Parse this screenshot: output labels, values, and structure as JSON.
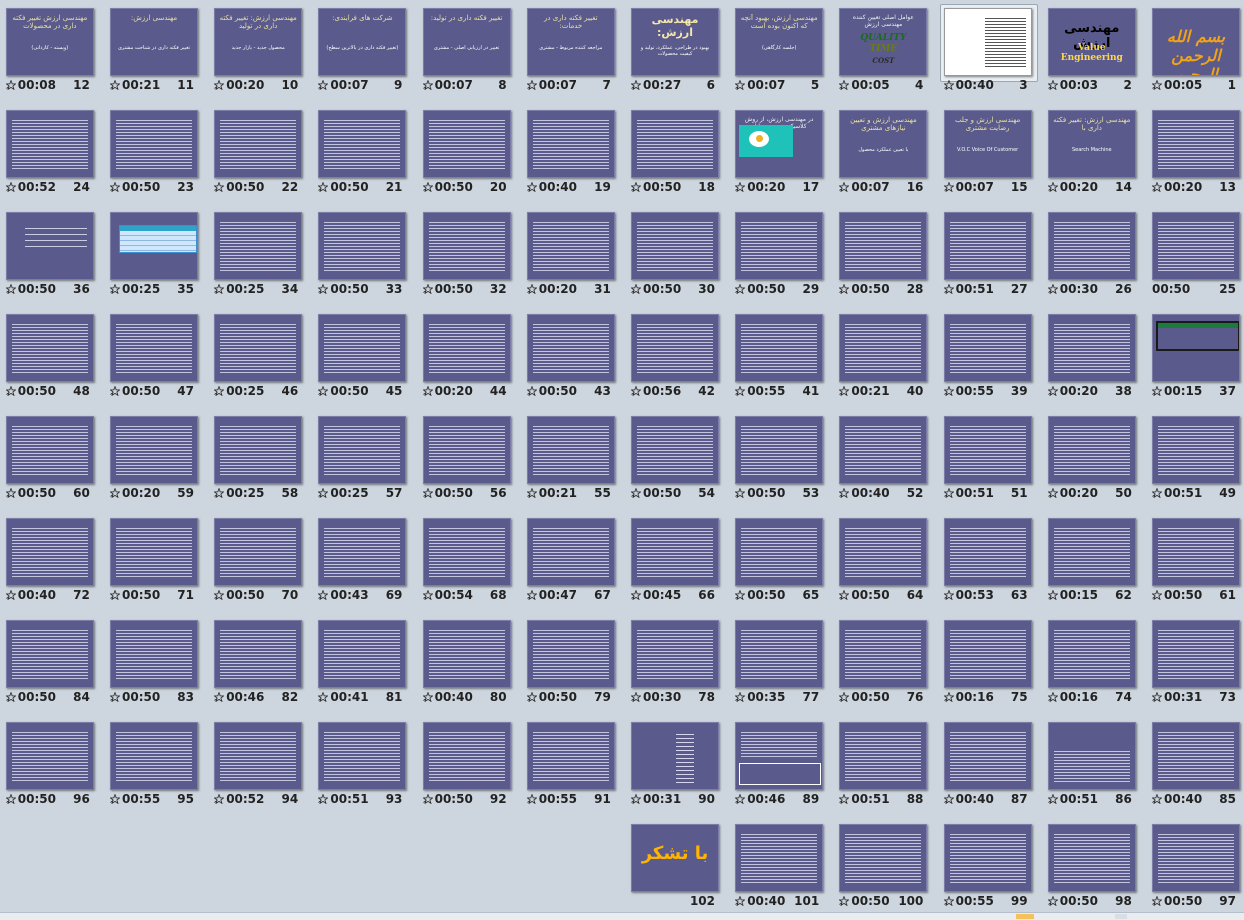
{
  "view": "slide-sorter",
  "colors": {
    "slide_bg": "#5a5a8c",
    "workspace_bg": "#cdd5de",
    "accent_gold": "#f0a218"
  },
  "selected_slide": 3,
  "slides": [
    {
      "num": "1",
      "time": "00:05",
      "kind": "bismillah",
      "title": "بسم الله الرحمن الرحیم"
    },
    {
      "num": "2",
      "time": "00:03",
      "kind": "ve-logo",
      "title": "مهندسی ارزش",
      "sub": "Value Engineering"
    },
    {
      "num": "3",
      "time": "00:40",
      "kind": "white-text"
    },
    {
      "num": "4",
      "time": "00:05",
      "kind": "qtc",
      "title": "عوامل اصلی تعیین کننده مهندسی ارزش",
      "lines3": [
        "QUALITY",
        "TIME",
        "COST"
      ]
    },
    {
      "num": "5",
      "time": "00:07",
      "kind": "title",
      "title": "مهندسی ارزش، بهبود آنچه که اکنون بوده است",
      "sub": "(جلسه کارگاهی)"
    },
    {
      "num": "6",
      "time": "00:27",
      "kind": "title-big",
      "title": "مهندسی ارزش:",
      "sub": "بهبود در طراحی، عملکرد، تولید و کیفیت محصولات"
    },
    {
      "num": "7",
      "time": "00:07",
      "kind": "title",
      "title": "تغییر فکته داری در خدمات:",
      "sub": "مراجعه کننده مربوط - مشتری"
    },
    {
      "num": "8",
      "time": "00:07",
      "kind": "title",
      "title": "تغییر فکته داری در تولید:",
      "sub": "تغییر در ارزیابی اصلی - مشتری"
    },
    {
      "num": "9",
      "time": "00:07",
      "kind": "title",
      "title": "شرکت های فرایندی:",
      "sub": "(تغییر فکته داری در بالاترین سطح)"
    },
    {
      "num": "10",
      "time": "00:20",
      "kind": "title",
      "title": "مهندسی ارزش: تغییر فکته داری در تولید",
      "sub": "محصول جدید - بازار جدید"
    },
    {
      "num": "11",
      "time": "00:21",
      "kind": "title",
      "title": "مهندسی ارزش:",
      "sub": "تغییر فکته داری در شناخت مشتری"
    },
    {
      "num": "12",
      "time": "00:08",
      "kind": "title",
      "title": "مهندسی ارزش تغییر فکته داری در محصولات",
      "sub": "(ویسته - کاردانی)"
    },
    {
      "num": "13",
      "time": "00:20",
      "kind": "text"
    },
    {
      "num": "14",
      "time": "00:20",
      "kind": "title",
      "title": "مهندسی ارزش: تغییر فکته داری با",
      "sub": "Search Machine"
    },
    {
      "num": "15",
      "time": "00:07",
      "kind": "title",
      "title": "مهندسی ارزش و جلب رضایت مشتری",
      "sub": "V.O.C Voice Of Customer"
    },
    {
      "num": "16",
      "time": "00:07",
      "kind": "title",
      "title": "مهندسی ارزش و تعیین نیازهای مشتری",
      "sub": "با تعیین عملکرد محصول"
    },
    {
      "num": "17",
      "time": "00:20",
      "kind": "image17",
      "title": "در مهندسی ارزش، از روش کلاسیک تجزیه و تحلیل"
    },
    {
      "num": "18",
      "time": "00:50",
      "kind": "text"
    },
    {
      "num": "19",
      "time": "00:40",
      "kind": "text"
    },
    {
      "num": "20",
      "time": "00:50",
      "kind": "text"
    },
    {
      "num": "21",
      "time": "00:50",
      "kind": "text"
    },
    {
      "num": "22",
      "time": "00:50",
      "kind": "text"
    },
    {
      "num": "23",
      "time": "00:50",
      "kind": "text"
    },
    {
      "num": "24",
      "time": "00:52",
      "kind": "text"
    },
    {
      "num": "25",
      "time": "00:50",
      "kind": "text",
      "nostar": true
    },
    {
      "num": "26",
      "time": "00:30",
      "kind": "text"
    },
    {
      "num": "27",
      "time": "00:51",
      "kind": "text"
    },
    {
      "num": "28",
      "time": "00:50",
      "kind": "text"
    },
    {
      "num": "29",
      "time": "00:50",
      "kind": "text"
    },
    {
      "num": "30",
      "time": "00:50",
      "kind": "text"
    },
    {
      "num": "31",
      "time": "00:20",
      "kind": "text"
    },
    {
      "num": "32",
      "time": "00:50",
      "kind": "text"
    },
    {
      "num": "33",
      "time": "00:50",
      "kind": "text"
    },
    {
      "num": "34",
      "time": "00:25",
      "kind": "text"
    },
    {
      "num": "35",
      "time": "00:25",
      "kind": "table"
    },
    {
      "num": "36",
      "time": "00:50",
      "kind": "sparse"
    },
    {
      "num": "37",
      "time": "00:15",
      "kind": "box"
    },
    {
      "num": "38",
      "time": "00:20",
      "kind": "text"
    },
    {
      "num": "39",
      "time": "00:55",
      "kind": "text"
    },
    {
      "num": "40",
      "time": "00:21",
      "kind": "text"
    },
    {
      "num": "41",
      "time": "00:55",
      "kind": "text"
    },
    {
      "num": "42",
      "time": "00:56",
      "kind": "text"
    },
    {
      "num": "43",
      "time": "00:50",
      "kind": "text"
    },
    {
      "num": "44",
      "time": "00:20",
      "kind": "text"
    },
    {
      "num": "45",
      "time": "00:50",
      "kind": "text"
    },
    {
      "num": "46",
      "time": "00:25",
      "kind": "text"
    },
    {
      "num": "47",
      "time": "00:50",
      "kind": "text"
    },
    {
      "num": "48",
      "time": "00:50",
      "kind": "text"
    },
    {
      "num": "49",
      "time": "00:51",
      "kind": "text"
    },
    {
      "num": "50",
      "time": "00:20",
      "kind": "text"
    },
    {
      "num": "51",
      "time": "00:51",
      "kind": "text"
    },
    {
      "num": "52",
      "time": "00:40",
      "kind": "text"
    },
    {
      "num": "53",
      "time": "00:50",
      "kind": "text"
    },
    {
      "num": "54",
      "time": "00:50",
      "kind": "text"
    },
    {
      "num": "55",
      "time": "00:21",
      "kind": "text"
    },
    {
      "num": "56",
      "time": "00:50",
      "kind": "text"
    },
    {
      "num": "57",
      "time": "00:25",
      "kind": "text"
    },
    {
      "num": "58",
      "time": "00:25",
      "kind": "text"
    },
    {
      "num": "59",
      "time": "00:20",
      "kind": "text"
    },
    {
      "num": "60",
      "time": "00:50",
      "kind": "text"
    },
    {
      "num": "61",
      "time": "00:50",
      "kind": "text"
    },
    {
      "num": "62",
      "time": "00:15",
      "kind": "text"
    },
    {
      "num": "63",
      "time": "00:53",
      "kind": "text"
    },
    {
      "num": "64",
      "time": "00:50",
      "kind": "text"
    },
    {
      "num": "65",
      "time": "00:50",
      "kind": "text"
    },
    {
      "num": "66",
      "time": "00:45",
      "kind": "text"
    },
    {
      "num": "67",
      "time": "00:47",
      "kind": "text"
    },
    {
      "num": "68",
      "time": "00:54",
      "kind": "text"
    },
    {
      "num": "69",
      "time": "00:43",
      "kind": "text"
    },
    {
      "num": "70",
      "time": "00:50",
      "kind": "text"
    },
    {
      "num": "71",
      "time": "00:50",
      "kind": "text"
    },
    {
      "num": "72",
      "time": "00:40",
      "kind": "text"
    },
    {
      "num": "73",
      "time": "00:31",
      "kind": "text"
    },
    {
      "num": "74",
      "time": "00:16",
      "kind": "text"
    },
    {
      "num": "75",
      "time": "00:16",
      "kind": "text"
    },
    {
      "num": "76",
      "time": "00:50",
      "kind": "text"
    },
    {
      "num": "77",
      "time": "00:35",
      "kind": "text"
    },
    {
      "num": "78",
      "time": "00:30",
      "kind": "text"
    },
    {
      "num": "79",
      "time": "00:50",
      "kind": "text"
    },
    {
      "num": "80",
      "time": "00:40",
      "kind": "text"
    },
    {
      "num": "81",
      "time": "00:41",
      "kind": "text"
    },
    {
      "num": "82",
      "time": "00:46",
      "kind": "text"
    },
    {
      "num": "83",
      "time": "00:50",
      "kind": "text"
    },
    {
      "num": "84",
      "time": "00:50",
      "kind": "text"
    },
    {
      "num": "85",
      "time": "00:40",
      "kind": "text"
    },
    {
      "num": "86",
      "time": "00:51",
      "kind": "ve-small"
    },
    {
      "num": "87",
      "time": "00:40",
      "kind": "text"
    },
    {
      "num": "88",
      "time": "00:51",
      "kind": "text"
    },
    {
      "num": "89",
      "time": "00:46",
      "kind": "box89"
    },
    {
      "num": "90",
      "time": "00:31",
      "kind": "list90"
    },
    {
      "num": "91",
      "time": "00:55",
      "kind": "text"
    },
    {
      "num": "92",
      "time": "00:50",
      "kind": "text"
    },
    {
      "num": "93",
      "time": "00:51",
      "kind": "text"
    },
    {
      "num": "94",
      "time": "00:52",
      "kind": "text"
    },
    {
      "num": "95",
      "time": "00:55",
      "kind": "text"
    },
    {
      "num": "96",
      "time": "00:50",
      "kind": "text"
    },
    {
      "num": "97",
      "time": "00:50",
      "kind": "text"
    },
    {
      "num": "98",
      "time": "00:50",
      "kind": "text"
    },
    {
      "num": "99",
      "time": "00:55",
      "kind": "text"
    },
    {
      "num": "100",
      "time": "00:50",
      "kind": "text"
    },
    {
      "num": "101",
      "time": "00:40",
      "kind": "text"
    },
    {
      "num": "102",
      "time": "",
      "kind": "thanks",
      "title": "با تشکر"
    }
  ]
}
